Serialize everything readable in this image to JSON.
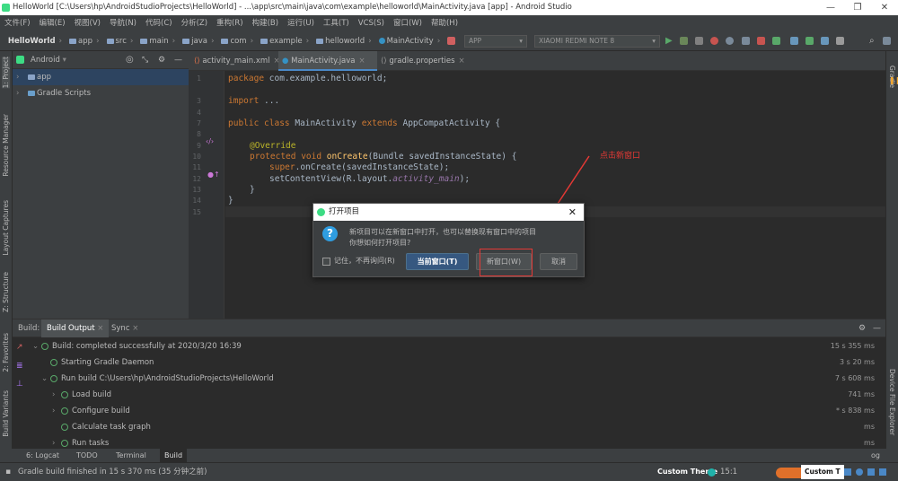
{
  "window": {
    "title": "HelloWorld [C:\\Users\\hp\\AndroidStudioProjects\\HelloWorld] - ...\\app\\src\\main\\java\\com\\example\\helloworld\\MainActivity.java [app] - Android Studio",
    "minimize": "—",
    "restore": "❐",
    "close": "✕"
  },
  "menu": [
    "文件(F)",
    "编辑(E)",
    "视图(V)",
    "导航(N)",
    "代码(C)",
    "分析(Z)",
    "重构(R)",
    "构建(B)",
    "运行(U)",
    "工具(T)",
    "VCS(S)",
    "窗口(W)",
    "帮助(H)"
  ],
  "breadcrumb": {
    "project": "HelloWorld",
    "items": [
      "app",
      "src",
      "main",
      "java",
      "com",
      "example",
      "helloworld",
      "MainActivity"
    ]
  },
  "toolbar": {
    "config": "APP",
    "device": "XIAOMI REDMI NOTE 8"
  },
  "left_stripe": {
    "project": "1: Project",
    "resource_manager": "Resource Manager",
    "layout_captures": "Layout Captures",
    "structure": "Z: Structure",
    "favorites": "2: Favorites",
    "build_variants": "Build Variants"
  },
  "right_stripe": {
    "gradle": "Gradle",
    "device_explorer": "Device File Explorer"
  },
  "project_panel": {
    "view": "Android",
    "tree": [
      "app",
      "Gradle Scripts"
    ]
  },
  "editor": {
    "tabs": [
      "activity_main.xml",
      "MainActivity.java",
      "gradle.properties"
    ],
    "line_numbers": [
      "1",
      "3",
      "4",
      "7",
      "8",
      "9",
      "10",
      "11",
      "12",
      "13",
      "14",
      "15"
    ],
    "code": {
      "l1_kw": "package",
      "l1_rest": " com.example.helloworld;",
      "l3_kw": "import",
      "l3_rest": " ...",
      "l7_kw": "public class",
      "l7_name": " MainActivity ",
      "l7_ext": "extends",
      "l7_rest": " AppCompatActivity {",
      "l9": "@Override",
      "l10_kw": "protected void",
      "l10_fn": " onCreate",
      "l10_rest": "(Bundle savedInstanceState) {",
      "l11_kw": "super",
      "l11_rest": ".onCreate(savedInstanceState);",
      "l12_a": "setContentView(R.layout.",
      "l12_b": "activity_main",
      "l12_c": ");",
      "l13": "}",
      "l14": "}"
    }
  },
  "annotation": "点击新窗口",
  "dialog": {
    "title": "打开项目",
    "close": "✕",
    "icon": "?",
    "message_1": "新项目可以在新窗口中打开，也可以替换现有窗口中的项目",
    "message_2": "你想如何打开项目?",
    "remember": "记住，不再询问(R)",
    "current_window": "当前窗口(T)",
    "new_window": "新窗口(W)",
    "cancel": "取消"
  },
  "build_panel": {
    "label": "Build:",
    "tabs": [
      "Build Output",
      "Sync"
    ],
    "rows": [
      {
        "text": "Build: completed successfully at 2020/3/20 16:39",
        "time": "15 s 355 ms"
      },
      {
        "text": "Starting Gradle Daemon",
        "time": "3 s 20 ms"
      },
      {
        "text": "Run build C:\\Users\\hp\\AndroidStudioProjects\\HelloWorld",
        "time": "7 s 608 ms"
      },
      {
        "text": "Load build",
        "time": "741 ms"
      },
      {
        "text": "Configure build",
        "time": "* s 838 ms"
      },
      {
        "text": "Calculate task graph",
        "time": "ms"
      },
      {
        "text": "Run tasks",
        "time": "ms"
      }
    ]
  },
  "bottom_tabs": [
    "6: Logcat",
    "TODO",
    "Terminal",
    "Build"
  ],
  "event_log": "og",
  "status": {
    "message": "Gradle build finished in 15 s 370 ms (35 分钟之前)",
    "theme": "Custom Theme",
    "position": "15:1",
    "theme2": "Custom T"
  },
  "colors": {
    "accent": "#365880",
    "success": "#59a869",
    "annotation_red": "#e53935"
  }
}
